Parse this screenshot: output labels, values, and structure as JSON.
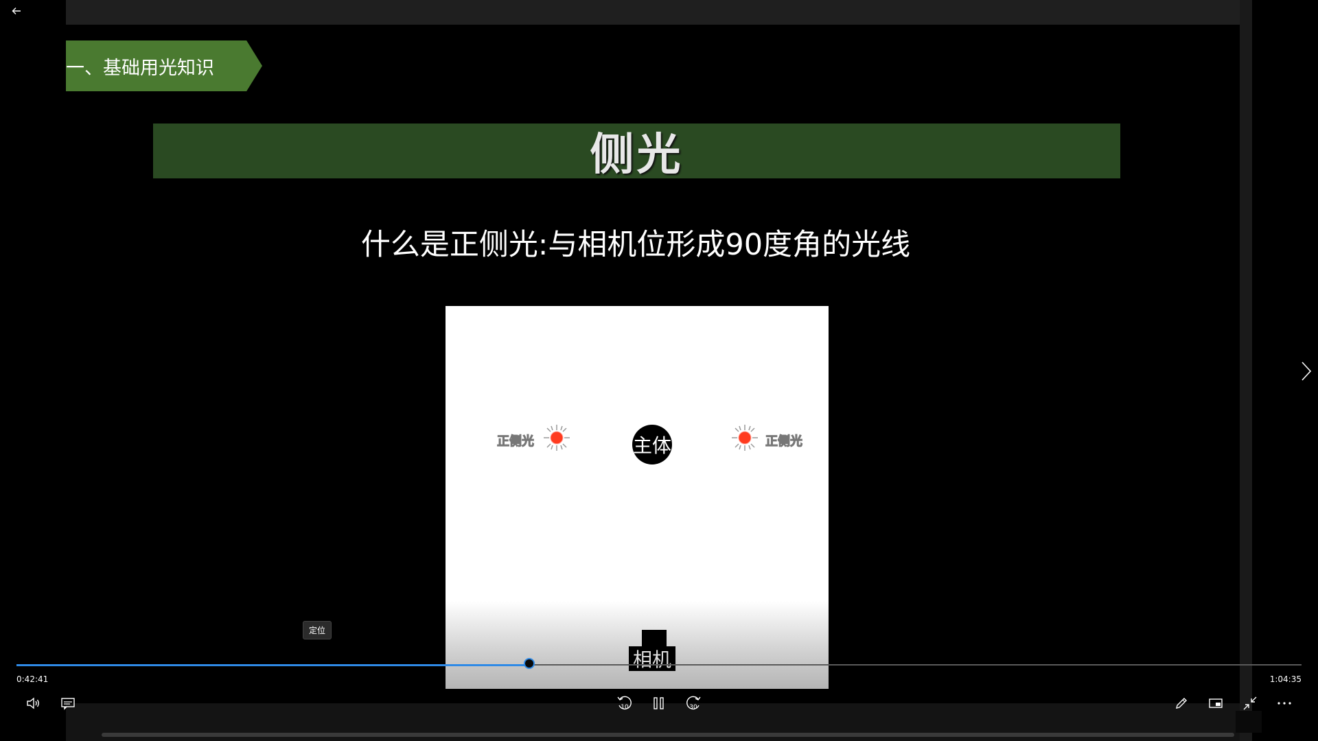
{
  "slide": {
    "section_tag": "一、基础用光知识",
    "title": "侧光",
    "subtitle": "什么是正侧光:与相机位形成90度角的光线",
    "diagram": {
      "left_light_label": "正侧光",
      "right_light_label": "正侧光",
      "subject_label": "主体",
      "camera_label": "相机"
    }
  },
  "player": {
    "tooltip": "定位",
    "current_time": "0:42:41",
    "total_time": "1:04:35",
    "progress_fraction": 0.399,
    "skip_back_seconds": "10",
    "skip_forward_seconds": "30",
    "accent_color": "#2f8ae6",
    "icons": [
      "back-arrow-icon",
      "volume-icon",
      "subtitles-icon",
      "rewind-10-icon",
      "pause-icon",
      "forward-30-icon",
      "pen-icon",
      "mini-view-icon",
      "exit-fullscreen-icon",
      "more-icon",
      "chevron-right-icon"
    ]
  },
  "colors": {
    "section_tag_bg": "#4a7a30",
    "title_bar_bg": "#2a4a22",
    "light_red": "#ff3b1f"
  }
}
